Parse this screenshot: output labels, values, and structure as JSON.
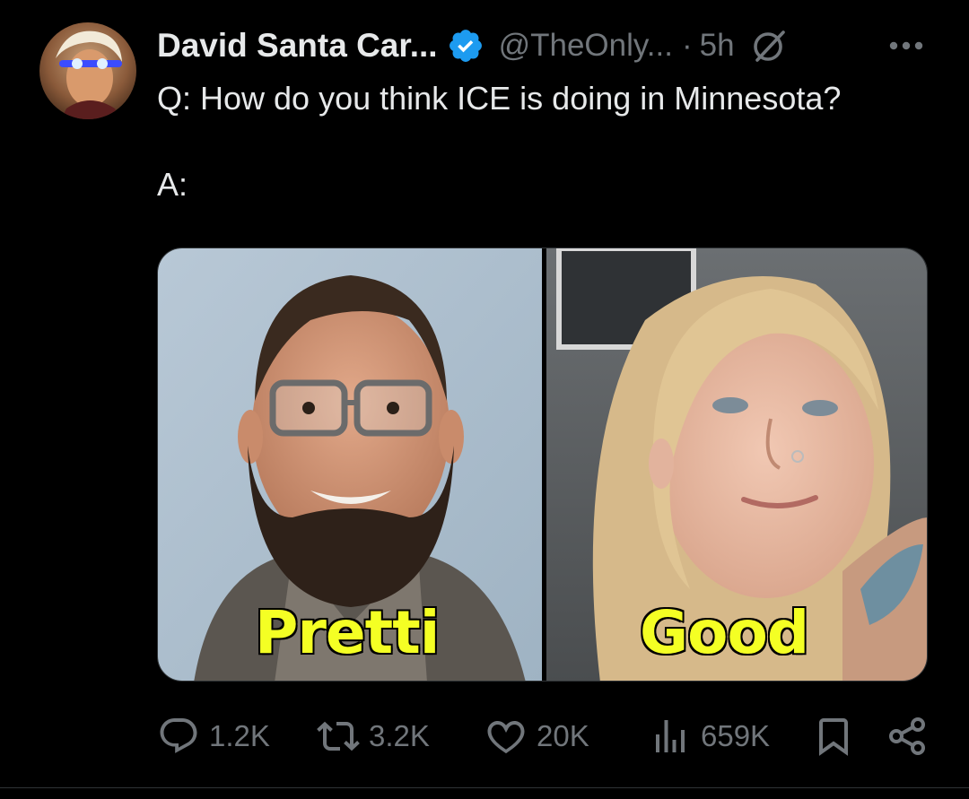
{
  "author": {
    "display_name": "David Santa Car...",
    "handle": "@TheOnly...",
    "separator": "·",
    "time": "5h",
    "avatar_icon": "user-avatar",
    "verified_icon": "verified-badge-icon",
    "verified_color": "#1d9bf0"
  },
  "tweet": {
    "question": "Q: How do you think ICE is doing in Minnesota?",
    "answer": "A:"
  },
  "media": {
    "left_caption": "Pretti",
    "right_caption": "Good",
    "caption_color": "#f4ff24"
  },
  "actions": {
    "reply_count": "1.2K",
    "retweet_count": "3.2K",
    "like_count": "20K",
    "view_count": "659K",
    "icons": [
      "reply-icon",
      "retweet-icon",
      "like-icon",
      "views-icon",
      "bookmark-icon",
      "share-icon"
    ]
  },
  "colors": {
    "background": "#000000",
    "primary_text": "#e7e9ea",
    "secondary_text": "#71767b",
    "accent": "#1d9bf0"
  }
}
